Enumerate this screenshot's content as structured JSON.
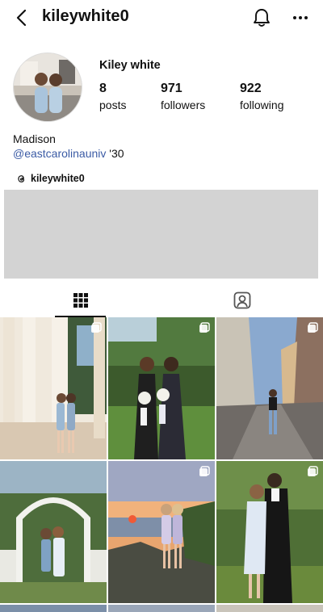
{
  "header": {
    "username": "kileywhite0",
    "icons": {
      "back": "chevron-left-icon",
      "notifications": "bell-icon",
      "more": "more-horizontal-icon"
    }
  },
  "profile": {
    "display_name": "Kiley white",
    "stats": [
      {
        "value": "8",
        "label": "posts"
      },
      {
        "value": "971",
        "label": "followers"
      },
      {
        "value": "922",
        "label": "following"
      }
    ],
    "bio": {
      "name_line": "Madison",
      "link_text": "@eastcarolinauniv",
      "link_suffix": " '30"
    },
    "threads_handle": "kileywhite0"
  },
  "tabs": [
    {
      "icon": "grid-icon",
      "active": true
    },
    {
      "icon": "tagged-person-icon",
      "active": false
    }
  ],
  "posts": [
    {
      "scene": "columns-porch",
      "multi": true
    },
    {
      "scene": "garden-gowns",
      "multi": true
    },
    {
      "scene": "city-street",
      "multi": true
    },
    {
      "scene": "trellis-arch",
      "multi": false
    },
    {
      "scene": "sunset-rocks",
      "multi": true
    },
    {
      "scene": "prom-couple",
      "multi": true
    }
  ],
  "colors": {
    "link": "#3b5ba5",
    "placeholder": "#d3d3d3"
  }
}
